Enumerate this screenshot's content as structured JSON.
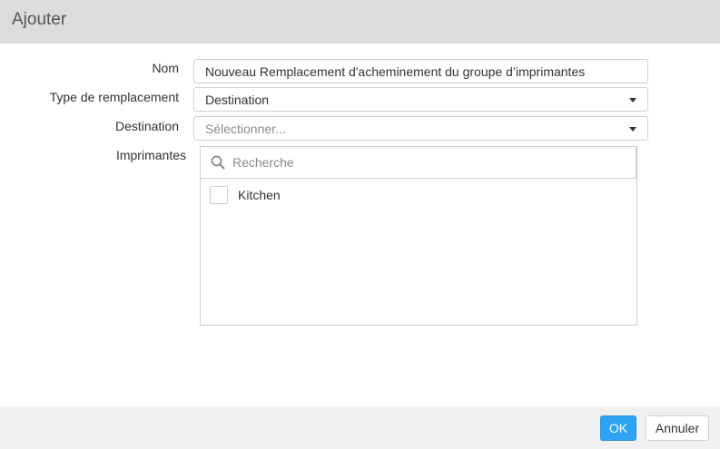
{
  "dialog": {
    "title": "Ajouter"
  },
  "form": {
    "name": {
      "label": "Nom",
      "value": "Nouveau Remplacement d'acheminement du groupe d’imprimantes"
    },
    "replacement_type": {
      "label": "Type de remplacement",
      "value": "Destination"
    },
    "destination": {
      "label": "Destination",
      "placeholder": "Sélectionner..."
    },
    "printers": {
      "label": "Imprimantes",
      "search_placeholder": "Recherche",
      "items": [
        {
          "label": "Kitchen",
          "checked": false
        }
      ]
    }
  },
  "footer": {
    "ok_label": "OK",
    "cancel_label": "Annuler"
  },
  "colors": {
    "header_bg": "#dcdcdf",
    "footer_bg": "#f0f0f0",
    "primary_button": "#2ea3f2"
  }
}
